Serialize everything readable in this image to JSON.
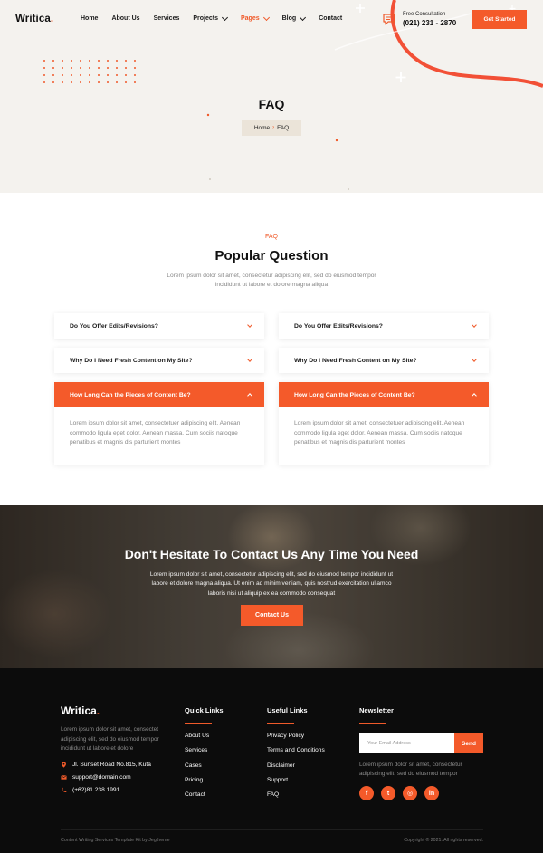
{
  "header": {
    "logo_text": "Writica",
    "logo_dot": ".",
    "nav": [
      {
        "label": "Home",
        "dropdown": false,
        "active": false
      },
      {
        "label": "About Us",
        "dropdown": false,
        "active": false
      },
      {
        "label": "Services",
        "dropdown": false,
        "active": false
      },
      {
        "label": "Projects",
        "dropdown": true,
        "active": false
      },
      {
        "label": "Pages",
        "dropdown": true,
        "active": true
      },
      {
        "label": "Blog",
        "dropdown": true,
        "active": false
      },
      {
        "label": "Contact",
        "dropdown": false,
        "active": false
      }
    ],
    "consult_label": "Free Consultation",
    "consult_phone": "(021) 231 - 2870",
    "cta_label": "Get Started"
  },
  "hero": {
    "title": "FAQ",
    "breadcrumb_home": "Home",
    "breadcrumb_sep": "›",
    "breadcrumb_current": "FAQ"
  },
  "faq": {
    "subtitle": "FAQ",
    "title": "Popular Question",
    "description": "Lorem ipsum dolor sit amet, consectetur adipiscing elit, sed do eiusmod tempor incididunt ut labore et dolore magna aliqua",
    "left": [
      {
        "question": "Do You Offer Edits/Revisions?",
        "open": false
      },
      {
        "question": "Why Do I Need Fresh Content on My Site?",
        "open": false
      },
      {
        "question": "How Long Can the Pieces of Content Be?",
        "open": true,
        "answer": "Lorem ipsum dolor sit amet, consectetuer adipiscing elit. Aenean commodo ligula eget dolor. Aenean massa. Cum sociis natoque penatibus et magnis dis parturient montes"
      }
    ],
    "right": [
      {
        "question": "Do You Offer Edits/Revisions?",
        "open": false
      },
      {
        "question": "Why Do I Need Fresh Content on My Site?",
        "open": false
      },
      {
        "question": "How Long Can the Pieces of Content Be?",
        "open": true,
        "answer": "Lorem ipsum dolor sit amet, consectetuer adipiscing elit. Aenean commodo ligula eget dolor. Aenean massa. Cum sociis natoque penatibus et magnis dis parturient montes"
      }
    ]
  },
  "cta": {
    "title": "Don't Hesitate To Contact Us Any Time You Need",
    "description": "Lorem ipsum dolor sit amet, consectetur adipiscing elit, sed do eiusmod tempor incididunt ut labore et dolore magna aliqua. Ut enim ad minim veniam, quis nostrud exercitation ullamco laboris nisi ut aliquip ex ea commodo consequat",
    "button": "Contact Us"
  },
  "footer": {
    "logo_text": "Writica",
    "logo_dot": ".",
    "description": "Lorem ipsum dolor sit amet, consectet adipiscing elit, sed do eiusmod tempor incididunt ut labore et dolore",
    "address": "Jl. Sunset Road No.815, Kuta",
    "email": "support@domain.com",
    "phone": "(+62)81 238 1991",
    "quick_links_title": "Quick Links",
    "quick_links": [
      "About Us",
      "Services",
      "Cases",
      "Pricing",
      "Contact"
    ],
    "useful_links_title": "Useful Links",
    "useful_links": [
      "Privacy Policy",
      "Terms and Conditions",
      "Disclaimer",
      "Support",
      "FAQ"
    ],
    "newsletter_title": "Newsletter",
    "newsletter_placeholder": "Your Email Address",
    "newsletter_button": "Send",
    "newsletter_desc": "Lorem ipsum dolor sit amet, consectetur adipiscing elit, sed do eiusmod tempor",
    "socials": [
      {
        "name": "facebook-icon",
        "glyph": "f"
      },
      {
        "name": "twitter-icon",
        "glyph": "t"
      },
      {
        "name": "instagram-icon",
        "glyph": "◎"
      },
      {
        "name": "linkedin-icon",
        "glyph": "in"
      }
    ],
    "credit": "Content Writing Services Template Kit by Jegtheme",
    "copyright": "Copyright © 2021. All rights reserved."
  },
  "colors": {
    "accent": "#f45a2a",
    "hero_bg": "#f4f2ee",
    "footer_bg": "#0c0c0c"
  }
}
